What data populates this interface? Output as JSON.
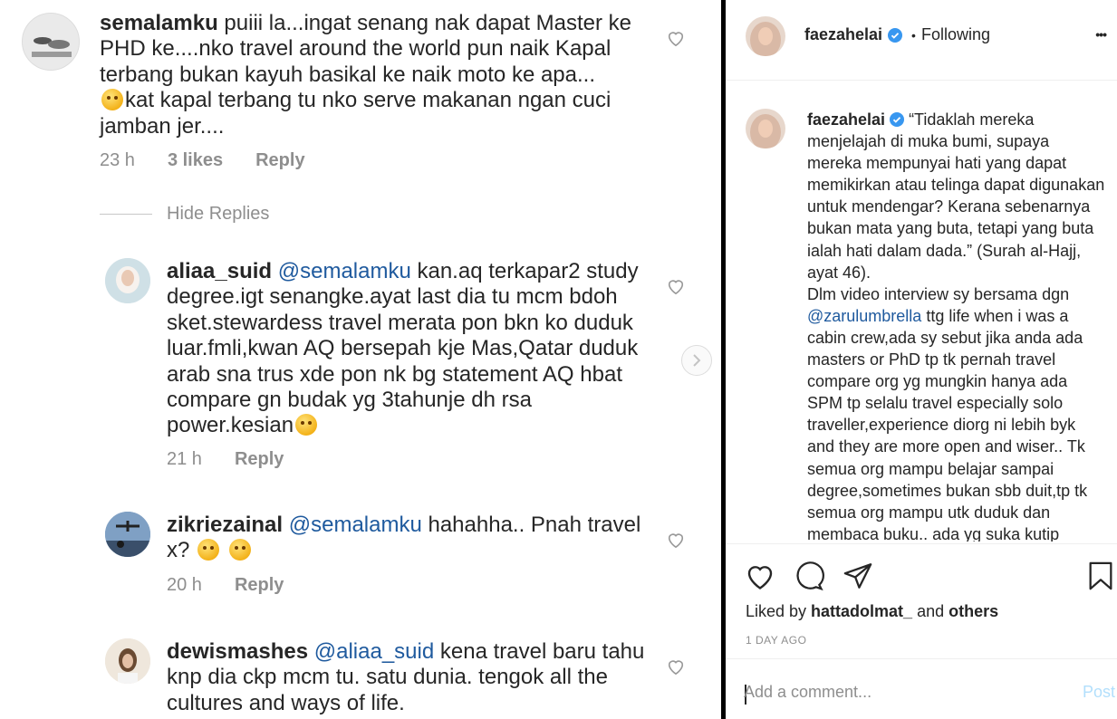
{
  "comments": [
    {
      "username": "semalamku",
      "text_a": " puiii la...ingat senang nak dapat Master ke PHD ke....nko travel around the world pun naik Kapal terbang bukan kayuh basikal ke naik moto ke apa...",
      "text_b": "kat kapal terbang tu nko serve makanan ngan cuci jamban jer....",
      "time": "23 h",
      "likes": "3 likes",
      "reply_label": "Reply"
    },
    {
      "username": "aliaa_suid",
      "mention": "@semalamku",
      "text_a": " kan.aq terkapar2 study degree.igt senangke.ayat last dia tu mcm bdoh sket.stewardess travel merata pon bkn ko duduk luar.fmli,kwan AQ bersepah kje Mas,Qatar duduk arab sna trus xde pon nk bg statement AQ hbat compare gn budak yg 3tahunje dh rsa power.kesian",
      "time": "21 h",
      "reply_label": "Reply"
    },
    {
      "username": "zikriezainal",
      "mention": "@semalamku",
      "text_a": " hahahha.. Pnah travel x? ",
      "time": "20 h",
      "reply_label": "Reply"
    },
    {
      "username": "dewismashes",
      "mention": "@aliaa_suid",
      "text_a": " kena travel baru tahu knp dia ckp mcm tu. satu dunia. tengok all the cultures and ways of life."
    }
  ],
  "hide_replies_label": "Hide Replies",
  "icons": {
    "heart": "heart-outline-icon",
    "next": "chevron-right-icon",
    "comment": "comment-bubble-icon",
    "share": "paper-plane-icon",
    "save": "bookmark-icon",
    "more": "more-dots-icon",
    "verified": "verified-badge-icon"
  },
  "post": {
    "username": "faezahelai",
    "follow_status": "Following",
    "separator": "•",
    "more_label": "•••",
    "caption_user": "faezahelai",
    "caption_a": " “Tidaklah mereka menjelajah di muka bumi, supaya mereka mempunyai hati yang dapat memikirkan atau telinga dapat digunakan untuk mendengar? Kerana sebenarnya bukan mata yang buta, tetapi yang buta ialah hati dalam dada.” (Surah al-Hajj, ayat 46).",
    "caption_b": "Dlm video interview sy bersama dgn ",
    "caption_mention": "@zarulumbrella",
    "caption_c": " ttg life when i was a cabin crew,ada sy sebut jika anda ada masters or PhD tp tk pernah travel compare org yg mungkin hanya ada SPM tp selalu travel especially solo traveller,experience diorg ni lebih byk and they are more open and wiser.. Tk semua org mampu belajar sampai degree,sometimes bukan sbb duit,tp tk semua org mampu utk duduk dan membaca buku.. ada yg suka kutip",
    "liked_prefix": "Liked by ",
    "liked_user": "hattadolmat_",
    "liked_mid": " and ",
    "liked_others": "others",
    "date": "1 DAY AGO",
    "comment_placeholder": "Add a comment...",
    "post_label": "Post"
  },
  "colors": {
    "mention": "#1f5a9e",
    "muted": "#8e8e8e",
    "post_disabled": "#b2dffc",
    "verified": "#3897f0"
  }
}
